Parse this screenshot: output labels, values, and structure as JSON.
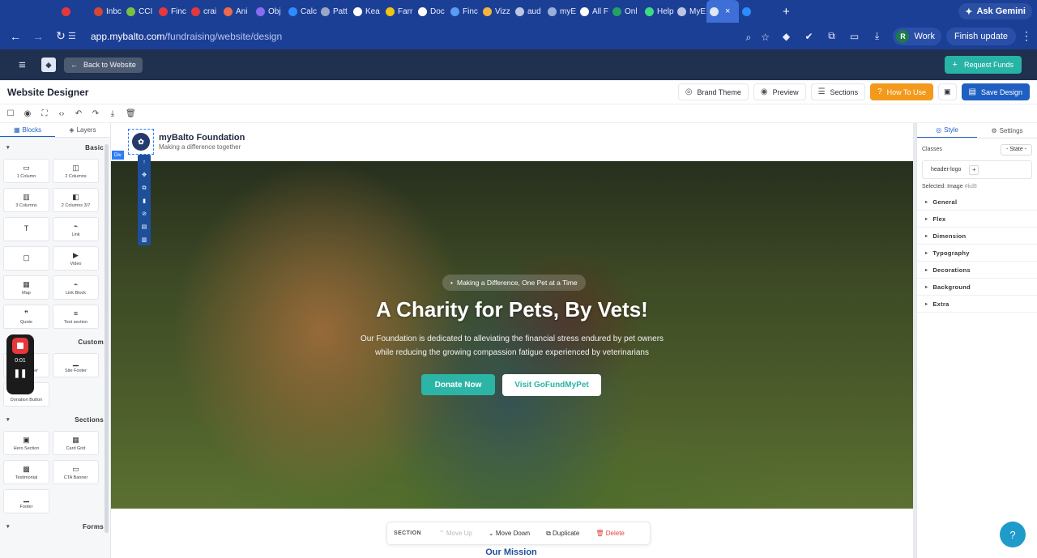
{
  "browser": {
    "tabs": [
      {
        "label": "",
        "color": "#e5383b"
      },
      {
        "label": "Inbc",
        "color": "#d44638"
      },
      {
        "label": "CCI",
        "color": "#7ac143"
      },
      {
        "label": "Finc",
        "color": "#e5383b"
      },
      {
        "label": "crai",
        "color": "#e5383b"
      },
      {
        "label": "Ani",
        "color": "#f06a4a"
      },
      {
        "label": "Obj",
        "color": "#8a6cf0"
      },
      {
        "label": "Calc",
        "color": "#2d8cff"
      },
      {
        "label": "Patt",
        "color": "#9aa7c7"
      },
      {
        "label": "Kea",
        "color": "#ffffff"
      },
      {
        "label": "Farr",
        "color": "#f1c40f"
      },
      {
        "label": "Doc",
        "color": "#ffffff"
      },
      {
        "label": "Finc",
        "color": "#5a9df3"
      },
      {
        "label": "Vizz",
        "color": "#f3b43c"
      },
      {
        "label": "aud",
        "color": "#bcc6e2"
      },
      {
        "label": "myE",
        "color": "#9ab0d8"
      },
      {
        "label": "All F",
        "color": "#ffffff"
      },
      {
        "label": "Onl",
        "color": "#21a366"
      },
      {
        "label": "Help",
        "color": "#3ddc84"
      },
      {
        "label": "MyE",
        "color": "#bcc6e2"
      },
      {
        "label": "",
        "color": "#dfe7f5"
      },
      {
        "label": "",
        "color": "#2d8cff"
      }
    ],
    "active_tab_index": 20,
    "ask_gemini": "Ask Gemini",
    "url_host": "app.mybalto.com",
    "url_path": "/fundraising/website/design",
    "profile_initial": "R",
    "profile_name": "Work",
    "finish_update": "Finish update"
  },
  "app": {
    "back_label": "Back to Website",
    "request_funds": "Request Funds",
    "title": "Website Designer",
    "actions": {
      "brand_theme": "Brand Theme",
      "preview": "Preview",
      "sections": "Sections",
      "how_to_use": "How To Use",
      "save_design": "Save Design"
    }
  },
  "left_panel": {
    "tabs": {
      "blocks": "Blocks",
      "layers": "Layers"
    },
    "sections": [
      {
        "title": "Basic",
        "items": [
          {
            "label": "1 Column",
            "icon": "▭"
          },
          {
            "label": "2 Columns",
            "icon": "◫"
          },
          {
            "label": "3 Columns",
            "icon": "▥"
          },
          {
            "label": "2 Columns 3/7",
            "icon": "◧"
          },
          {
            "label": "",
            "icon": "T"
          },
          {
            "label": "Link",
            "icon": "⌁"
          },
          {
            "label": "",
            "icon": "▢"
          },
          {
            "label": "Video",
            "icon": "▶"
          },
          {
            "label": "Map",
            "icon": "▦"
          },
          {
            "label": "Link Block",
            "icon": "⌁"
          },
          {
            "label": "Quote",
            "icon": "❞"
          },
          {
            "label": "Text section",
            "icon": "≡"
          }
        ]
      },
      {
        "title": "Custom",
        "items": [
          {
            "label": "Site Header",
            "icon": "▔"
          },
          {
            "label": "Site Footer",
            "icon": "▁"
          },
          {
            "label": "Donation Button",
            "icon": "♥"
          }
        ]
      },
      {
        "title": "Sections",
        "items": [
          {
            "label": "Hero Section",
            "icon": "▣"
          },
          {
            "label": "Card Grid",
            "icon": "▦"
          },
          {
            "label": "Testimonial",
            "icon": "▩"
          },
          {
            "label": "CTA Banner",
            "icon": "▭"
          },
          {
            "label": "Footer",
            "icon": "▁"
          }
        ]
      },
      {
        "title": "Forms",
        "items": []
      }
    ],
    "recording_time": "0:01"
  },
  "canvas": {
    "site_name": "myBalto Foundation",
    "site_tagline": "Making a difference together",
    "selected_badge": "Div",
    "hero_pill": "Making a Difference, One Pet at a Time",
    "hero_title": "A Charity for Pets, By Vets!",
    "hero_sub_1": "Our Foundation is dedicated to alleviating the financial stress endured by pet owners",
    "hero_sub_2": "while reducing the growing compassion fatigue experienced by veterinarians",
    "donate_label": "Donate Now",
    "visit_label": "Visit GoFundMyPet",
    "section_bar": {
      "label": "SECTION",
      "move_up": "Move Up",
      "move_down": "Move Down",
      "duplicate": "Duplicate",
      "delete": "Delete"
    },
    "next_heading": "Our Mission"
  },
  "right_panel": {
    "tabs": {
      "style": "Style",
      "settings": "Settings"
    },
    "classes_label": "Classes",
    "state_label": "- State -",
    "class_chip": "header-logo",
    "selected_label": "Selected:",
    "selected_value": "Image",
    "selected_id": "#kd8",
    "properties": [
      "General",
      "Flex",
      "Dimension",
      "Typography",
      "Decorations",
      "Background",
      "Extra"
    ]
  },
  "colors": {
    "brand_teal": "#27b3a6",
    "brand_blue": "#1f5fc2",
    "how_to_orange": "#f39a1c",
    "browser_blue": "#1c3f96",
    "app_navy": "#20304f"
  }
}
